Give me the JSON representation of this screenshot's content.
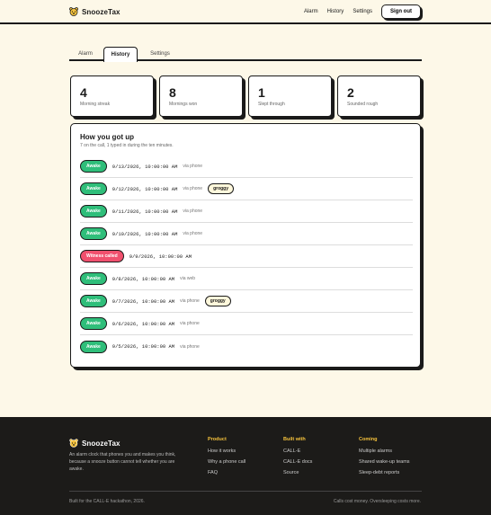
{
  "brand": {
    "name": "SnoozeTax",
    "logo_icon": "bear-face-icon"
  },
  "nav": {
    "alarm": "Alarm",
    "history": "History",
    "settings": "Settings",
    "sign_out": "Sign out"
  },
  "tabs": [
    {
      "label": "Alarm",
      "active": false
    },
    {
      "label": "History",
      "active": true
    },
    {
      "label": "Settings",
      "active": false
    }
  ],
  "stats": [
    {
      "value": "4",
      "label": "Morning streak"
    },
    {
      "value": "8",
      "label": "Mornings won"
    },
    {
      "value": "1",
      "label": "Slept through"
    },
    {
      "value": "2",
      "label": "Sounded rough"
    }
  ],
  "history": {
    "title": "How you got up",
    "subtitle": "7 on the call, 1 typed in during the ten minutes.",
    "rows": [
      {
        "status": "Awake",
        "kind": "awake",
        "timestamp": "9/13/2026, 10:00:00 AM",
        "via": "via phone",
        "tag": ""
      },
      {
        "status": "Awake",
        "kind": "awake",
        "timestamp": "9/12/2026, 10:00:00 AM",
        "via": "via phone",
        "tag": "groggy"
      },
      {
        "status": "Awake",
        "kind": "awake",
        "timestamp": "9/11/2026, 10:00:00 AM",
        "via": "via phone",
        "tag": ""
      },
      {
        "status": "Awake",
        "kind": "awake",
        "timestamp": "9/10/2026, 10:00:00 AM",
        "via": "via phone",
        "tag": ""
      },
      {
        "status": "Witness called",
        "kind": "missed",
        "timestamp": "9/9/2026, 10:00:00 AM",
        "via": "",
        "tag": ""
      },
      {
        "status": "Awake",
        "kind": "awake",
        "timestamp": "9/8/2026, 10:00:00 AM",
        "via": "via web",
        "tag": ""
      },
      {
        "status": "Awake",
        "kind": "awake",
        "timestamp": "9/7/2026, 10:00:00 AM",
        "via": "via phone",
        "tag": "groggy"
      },
      {
        "status": "Awake",
        "kind": "awake",
        "timestamp": "9/6/2026, 10:00:00 AM",
        "via": "via phone",
        "tag": ""
      },
      {
        "status": "Awake",
        "kind": "awake",
        "timestamp": "9/5/2026, 10:00:00 AM",
        "via": "via phone",
        "tag": ""
      }
    ]
  },
  "footer": {
    "brand": "SnoozeTax",
    "description": "An alarm clock that phones you and makes you think, because a snooze button cannot tell whether you are awake.",
    "columns": [
      {
        "heading": "Product",
        "links": [
          "How it works",
          "Why a phone call",
          "FAQ"
        ]
      },
      {
        "heading": "Built with",
        "links": [
          "CALL-E",
          "CALL-E docs",
          "Source"
        ]
      },
      {
        "heading": "Coming",
        "links": [
          "Multiple alarms",
          "Shared wake-up teams",
          "Sleep-debt reports"
        ]
      }
    ],
    "copyright": "Built for the CALL-E hackathon, 2026.",
    "tagline": "Calls cost money. Oversleeping costs more."
  },
  "colors": {
    "background": "#fdf8e8",
    "awake": "#2fbe7a",
    "missed": "#f0506e",
    "footer": "#1c1b19",
    "footer_heading": "#f5c23c"
  }
}
